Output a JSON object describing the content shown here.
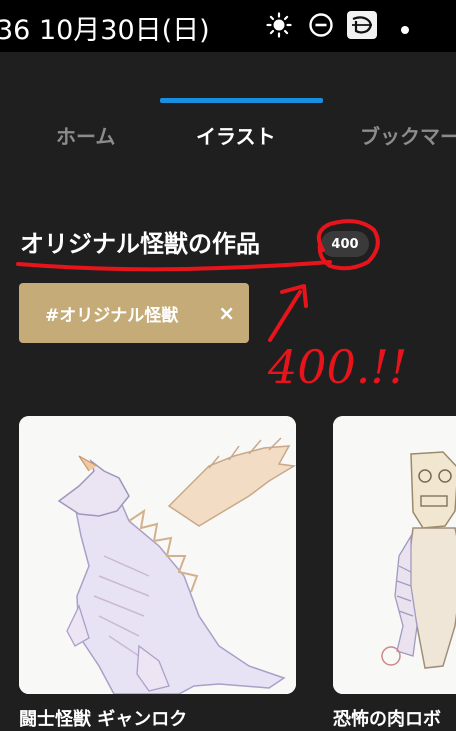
{
  "status_bar": {
    "time_date": "36  10月30日(日)",
    "icons": [
      "brightness-icon",
      "do-not-disturb-icon",
      "disney-app-icon",
      "notification-dot-icon"
    ]
  },
  "tabs": [
    {
      "label": "ホーム",
      "active": false
    },
    {
      "label": "イラスト",
      "active": true
    },
    {
      "label": "ブックマー",
      "active": false
    }
  ],
  "page": {
    "title": "オリジナル怪獣の作品",
    "count": "400"
  },
  "filter_tag": {
    "label": "#オリジナル怪獣",
    "remove": "×"
  },
  "artworks": [
    {
      "title": "闘士怪獣 ギャンロク"
    },
    {
      "title": "恐怖の肉ロボ"
    }
  ],
  "annotation": {
    "text": "400.!!",
    "color": "#e8141c"
  }
}
